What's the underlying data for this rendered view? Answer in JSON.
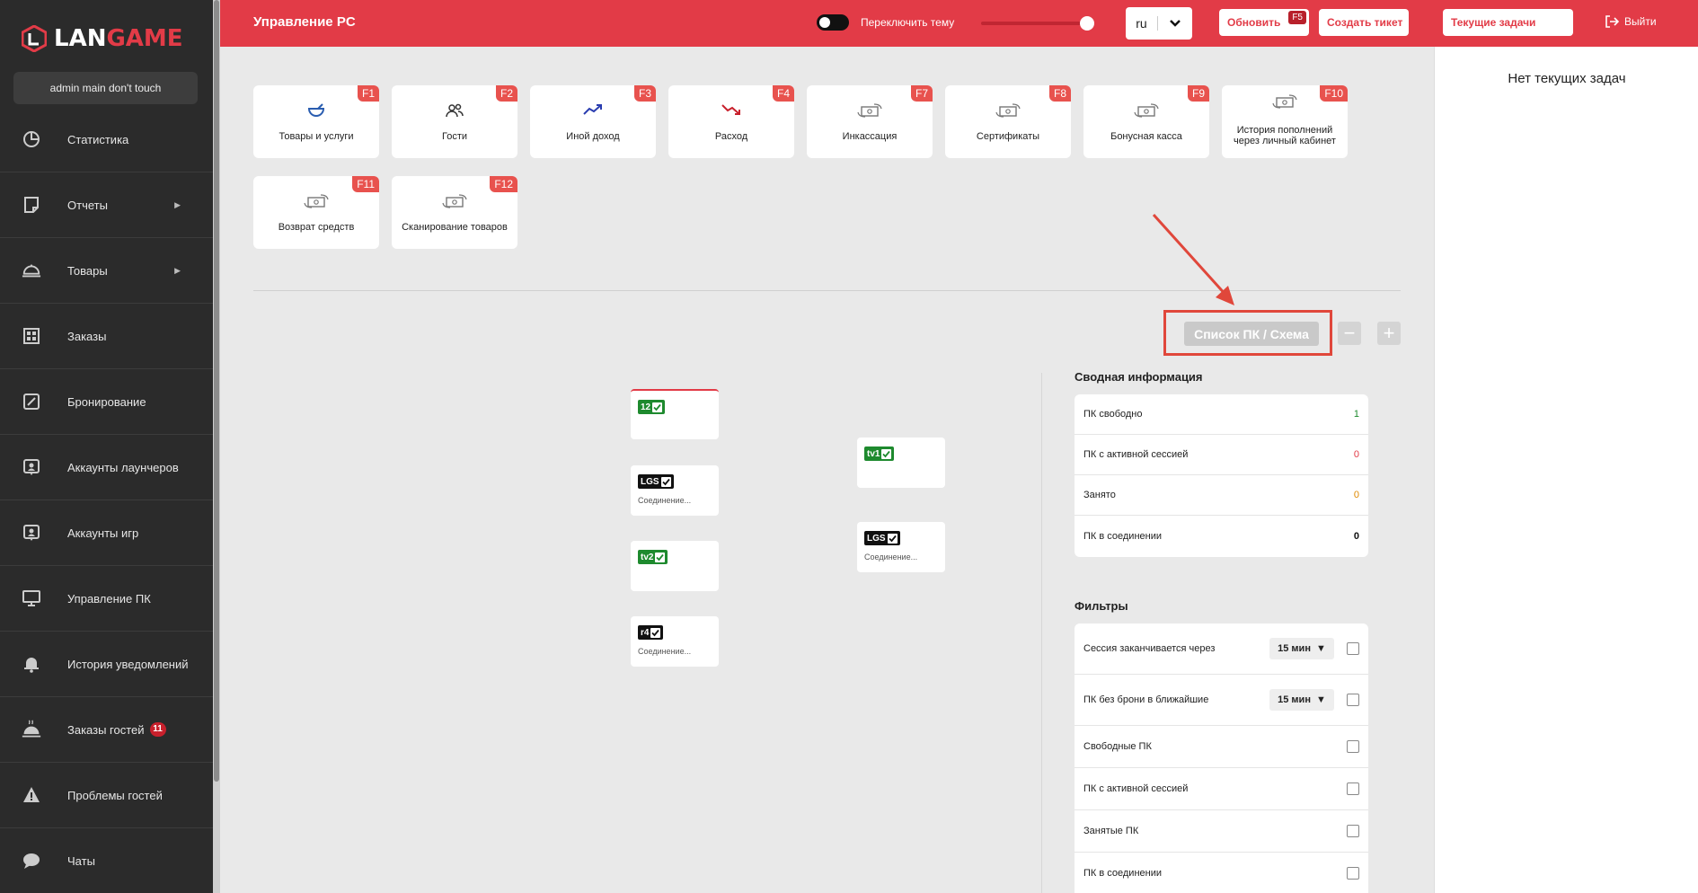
{
  "brand": {
    "logo_part1": "LAN",
    "logo_part2": "GAME"
  },
  "user": {
    "name": "admin main don't touch"
  },
  "sidebar": {
    "items": [
      {
        "label": "Статистика",
        "icon": "pie-chart-icon"
      },
      {
        "label": "Отчеты",
        "icon": "report-icon",
        "has_submenu": true
      },
      {
        "label": "Товары",
        "icon": "cloche-icon",
        "has_submenu": true
      },
      {
        "label": "Заказы",
        "icon": "grid-icon"
      },
      {
        "label": "Бронирование",
        "icon": "edit-icon"
      },
      {
        "label": "Аккаунты лаунчеров",
        "icon": "account-icon"
      },
      {
        "label": "Аккаунты игр",
        "icon": "account-icon"
      },
      {
        "label": "Управление ПК",
        "icon": "monitor-icon"
      },
      {
        "label": "История уведомлений",
        "icon": "bell-icon"
      },
      {
        "label": "Заказы гостей",
        "icon": "cloche-icon",
        "badge": "11"
      },
      {
        "label": "Проблемы гостей",
        "icon": "warning-icon"
      },
      {
        "label": "Чаты",
        "icon": "chat-icon"
      }
    ]
  },
  "header": {
    "title": "Управление PC",
    "theme_toggle_label": "Переключить тему",
    "language": "ru",
    "refresh_label": "Обновить",
    "refresh_key": "F5",
    "create_ticket_label": "Создать тикет",
    "current_tasks_label": "Текущие задачи",
    "logout_label": "Выйти"
  },
  "tiles": [
    {
      "label": "Товары и услуги",
      "key": "F1",
      "icon": "bowl-icon"
    },
    {
      "label": "Гости",
      "key": "F2",
      "icon": "users-icon"
    },
    {
      "label": "Иной доход",
      "key": "F3",
      "icon": "trend-up-icon"
    },
    {
      "label": "Расход",
      "key": "F4",
      "icon": "trend-down-icon"
    },
    {
      "label": "Инкассация",
      "key": "F7",
      "icon": "money-transfer-icon"
    },
    {
      "label": "Сертификаты",
      "key": "F8",
      "icon": "money-transfer-icon"
    },
    {
      "label": "Бонусная касса",
      "key": "F9",
      "icon": "money-transfer-icon"
    },
    {
      "label": "История пополнений через личный кабинет",
      "key": "F10",
      "icon": "money-transfer-icon"
    },
    {
      "label": "Возврат средств",
      "key": "F11",
      "icon": "money-transfer-icon"
    },
    {
      "label": "Сканирование товаров",
      "key": "F12",
      "icon": "money-transfer-icon"
    }
  ],
  "view_toggle": {
    "label": "Список ПК / Схема"
  },
  "zoom": {
    "minus": "−",
    "plus": "+"
  },
  "pcs": [
    {
      "tag": "12",
      "color": "#1e8a2e",
      "status": ""
    },
    {
      "tag": "LGS",
      "color": "#111111",
      "status": "Соединение..."
    },
    {
      "tag": "tv2",
      "color": "#1e8a2e",
      "status": ""
    },
    {
      "tag": "r4",
      "color": "#111111",
      "status": "Соединение..."
    },
    {
      "tag": "tv1",
      "color": "#1e8a2e",
      "status": ""
    },
    {
      "tag": "LGS",
      "color": "#111111",
      "status": "Соединение..."
    }
  ],
  "summary": {
    "title": "Сводная информация",
    "rows": [
      {
        "label": "ПК свободно",
        "value": "1",
        "color": "#1e8a2e"
      },
      {
        "label": "ПК с активной сессией",
        "value": "0",
        "color": "#e23b47"
      },
      {
        "label": "Занято",
        "value": "0",
        "color": "#e08a00"
      },
      {
        "label": "ПК в соединении",
        "value": "0",
        "color": "#111111"
      }
    ]
  },
  "filters": {
    "title": "Фильтры",
    "rows": [
      {
        "label": "Сессия заканчивается через",
        "select": "15 мин"
      },
      {
        "label": "ПК без брони в ближайшие",
        "select": "15 мин"
      },
      {
        "label": "Свободные ПК"
      },
      {
        "label": "ПК с активной сессией"
      },
      {
        "label": "Занятые ПК"
      },
      {
        "label": "ПК в соединении"
      }
    ]
  },
  "right_panel": {
    "empty_text": "Нет текущих задач"
  },
  "colors": {
    "accent": "#e23b47",
    "sidebar_bg": "#2b2b2b"
  }
}
